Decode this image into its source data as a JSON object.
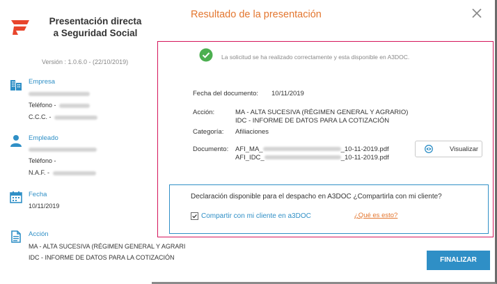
{
  "app": {
    "title_line1": "Presentación directa",
    "title_line2": "a Seguridad Social",
    "version": "Versión : 1.0.6.0 - (22/10/2019)"
  },
  "sidebar": {
    "empresa": {
      "heading": "Empresa",
      "telefono_label": "Teléfono -",
      "ccc_label": "C.C.C. -"
    },
    "empleado": {
      "heading": "Empleado",
      "telefono_label": "Teléfono -",
      "naf_label": "N.A.F. -"
    },
    "fecha": {
      "heading": "Fecha",
      "value": "10/11/2019"
    },
    "accion": {
      "heading": "Acción",
      "line1": "MA - ALTA SUCESIVA (RÉGIMEN GENERAL Y AGRARI",
      "line2": "IDC - INFORME DE DATOS PARA LA COTIZACIÓN"
    }
  },
  "main": {
    "title": "Resultado de la presentación",
    "success_message": "La solicitud se ha realizado correctamente y esta disponible en A3DOC.",
    "fecha_documento_label": "Fecha del documento:",
    "fecha_documento_value": "10/11/2019",
    "accion_label": "Acción:",
    "accion_line1": "MA - ALTA SUCESIVA (RÉGIMEN GENERAL Y AGRARIO)",
    "accion_line2": "IDC - INFORME DE DATOS PARA LA COTIZACIÓN",
    "categoria_label": "Categoría:",
    "categoria_value": "Afiliaciones",
    "documento_label": "Documento:",
    "documento_1_prefix": "AFI_MA_",
    "documento_1_suffix": "_10-11-2019.pdf",
    "documento_2_prefix": "AFI_IDC_",
    "documento_2_suffix": "_10-11-2019.pdf",
    "view_button": "Visualizar",
    "share_question": "Declaración disponible para el despacho en A3DOC ¿Compartirla con mi cliente?",
    "share_checkbox_label": "Compartir con mi cliente en a3DOC",
    "share_checked": true,
    "help_link": "¿Qué es esto?",
    "finish_button": "FINALIZAR"
  },
  "colors": {
    "accent_blue": "#2f8fc6",
    "accent_orange": "#e3762f",
    "panel_border": "#d4145a",
    "success_green": "#4caf50"
  },
  "icons": {
    "logo": "a3-logo",
    "empresa": "building-icon",
    "empleado": "person-icon",
    "fecha": "calendar-icon",
    "accion": "document-icon",
    "success": "check-circle-icon",
    "view": "eye-icon",
    "close": "close-icon"
  }
}
